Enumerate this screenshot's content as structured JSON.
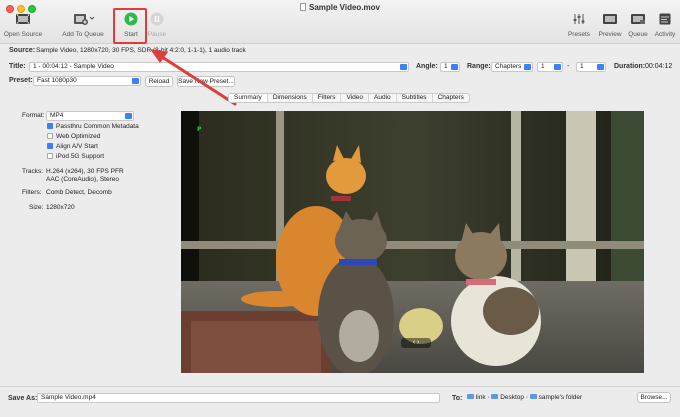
{
  "window": {
    "title": "Sample Video.mov"
  },
  "toolbar": {
    "open_source": "Open Source",
    "add_to_queue": "Add To Queue",
    "start": "Start",
    "pause": "Pause",
    "presets": "Presets",
    "preview": "Preview",
    "queue": "Queue",
    "activity": "Activity"
  },
  "source": {
    "label": "Source:",
    "value": "Sample Video, 1280x720, 30 FPS, SDR (8-bit 4:2:0, 1-1-1), 1 audio track"
  },
  "title_row": {
    "label": "Title:",
    "value": "1 - 00:04:12 - Sample Video",
    "angle_label": "Angle:",
    "angle_value": "1",
    "range_label": "Range:",
    "range_type": "Chapters",
    "range_start": "1",
    "range_sep": "-",
    "range_end": "1",
    "duration_label": "Duration:",
    "duration_value": "00:04:12"
  },
  "preset_row": {
    "label": "Preset:",
    "value": "Fast 1080p30",
    "reload": "Reload",
    "save_new": "Save New Preset..."
  },
  "tabs": [
    "Summary",
    "Dimensions",
    "Filters",
    "Video",
    "Audio",
    "Subtitles",
    "Chapters"
  ],
  "summary": {
    "format_label": "Format:",
    "format_value": "MP4",
    "options": [
      {
        "label": "Passthru Common Metadata",
        "checked": true
      },
      {
        "label": "Web Optimized",
        "checked": false
      },
      {
        "label": "Align A/V Start",
        "checked": true
      },
      {
        "label": "iPod 5G Support",
        "checked": false
      }
    ],
    "tracks_label": "Tracks:",
    "tracks_line1": "H.264 (x264), 30 FPS PFR",
    "tracks_line2": "AAC (CoreAudio), Stereo",
    "filters_label": "Filters:",
    "filters_value": "Comb Detect, Decomb",
    "size_label": "Size:",
    "size_value": "1280x720"
  },
  "preview": {
    "overlay": "‹   ›"
  },
  "bottom": {
    "save_as_label": "Save As:",
    "save_as_value": "Sample Video.mp4",
    "to_label": "To:",
    "path": [
      "link",
      "Desktop",
      "sample's folder"
    ],
    "browse": "Browse..."
  },
  "colors": {
    "accent": "#3b82f6",
    "start_green": "#2fb84a",
    "annotation_red": "#e23b3b"
  }
}
